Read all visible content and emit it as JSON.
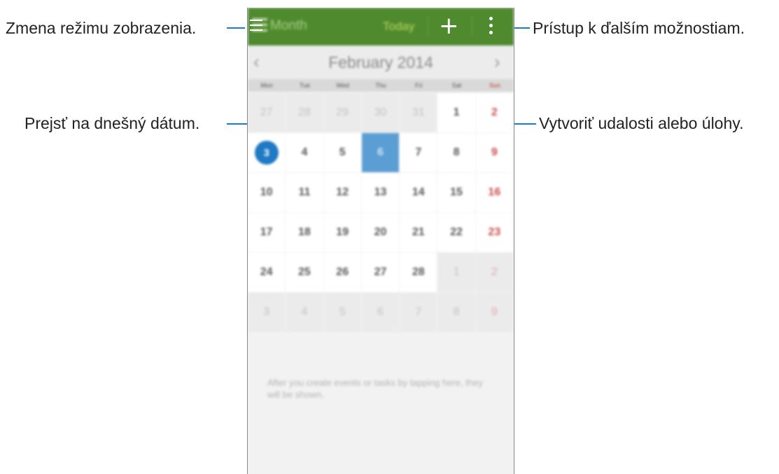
{
  "callouts": {
    "view_mode": "Zmena režimu zobrazenia.",
    "more_options": "Prístup k ďalším možnostiam.",
    "go_today": "Prejsť na dnešný dátum.",
    "create_event": "Vytvoriť udalosti alebo úlohy."
  },
  "actionbar": {
    "title": "Month",
    "today_label": "Today",
    "add_label": "+",
    "more_label": "⋮",
    "menu_icon": "hamburger-menu-icon",
    "color": "#4f8a2f"
  },
  "monthbar": {
    "label": "February 2014",
    "prev": "‹",
    "next": "›"
  },
  "weekdays": [
    "Mon",
    "Tue",
    "Wed",
    "Thu",
    "Fri",
    "Sat",
    "Sun"
  ],
  "weeks": [
    [
      {
        "d": "27",
        "other": true
      },
      {
        "d": "28",
        "other": true
      },
      {
        "d": "29",
        "other": true
      },
      {
        "d": "30",
        "other": true
      },
      {
        "d": "31",
        "other": true
      },
      {
        "d": "1"
      },
      {
        "d": "2"
      }
    ],
    [
      {
        "d": "3",
        "today": true
      },
      {
        "d": "4"
      },
      {
        "d": "5"
      },
      {
        "d": "6",
        "selected": true
      },
      {
        "d": "7"
      },
      {
        "d": "8"
      },
      {
        "d": "9"
      }
    ],
    [
      {
        "d": "10"
      },
      {
        "d": "11"
      },
      {
        "d": "12"
      },
      {
        "d": "13"
      },
      {
        "d": "14"
      },
      {
        "d": "15"
      },
      {
        "d": "16"
      }
    ],
    [
      {
        "d": "17"
      },
      {
        "d": "18"
      },
      {
        "d": "19"
      },
      {
        "d": "20"
      },
      {
        "d": "21"
      },
      {
        "d": "22"
      },
      {
        "d": "23"
      }
    ],
    [
      {
        "d": "24"
      },
      {
        "d": "25"
      },
      {
        "d": "26"
      },
      {
        "d": "27"
      },
      {
        "d": "28"
      },
      {
        "d": "1",
        "other": true
      },
      {
        "d": "2",
        "other": true
      }
    ],
    [
      {
        "d": "3",
        "other": true
      },
      {
        "d": "4",
        "other": true
      },
      {
        "d": "5",
        "other": true
      },
      {
        "d": "6",
        "other": true
      },
      {
        "d": "7",
        "other": true
      },
      {
        "d": "8",
        "other": true
      },
      {
        "d": "9",
        "other": true
      }
    ]
  ],
  "empty_message": "After you create events or tasks by tapping here, they will be shown."
}
